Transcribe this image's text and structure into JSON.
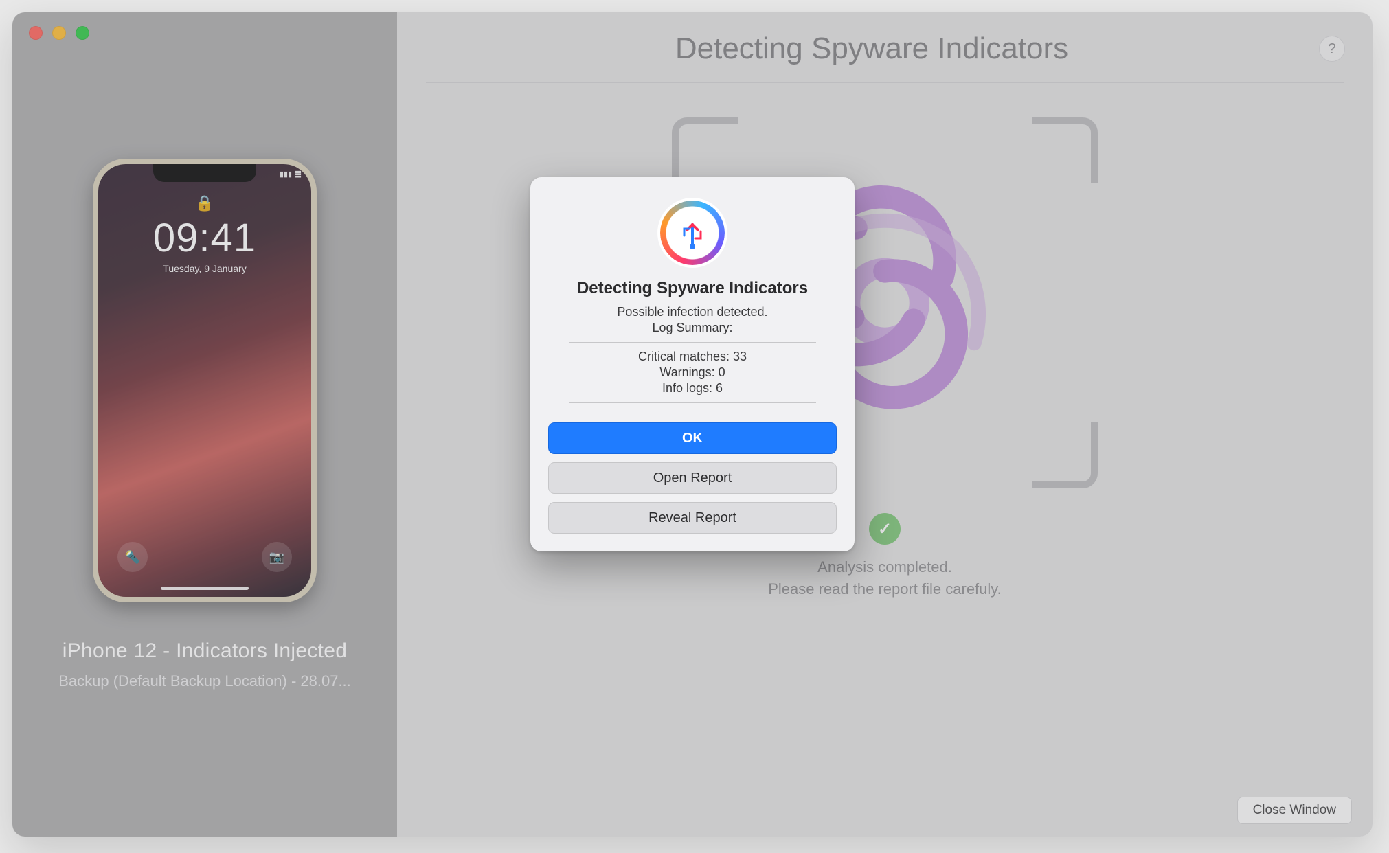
{
  "header": {
    "title": "Detecting Spyware Indicators"
  },
  "sidebar": {
    "phone_time": "09:41",
    "phone_date": "Tuesday, 9 January",
    "device_title": "iPhone 12 - Indicators Injected",
    "device_sub": "Backup (Default Backup Location) - 28.07..."
  },
  "scan": {
    "result_line1": "Analysis completed.",
    "result_line2": "Please read the report file carefuly."
  },
  "modal": {
    "title": "Detecting Spyware Indicators",
    "line1": "Possible infection detected.",
    "line2": "Log Summary:",
    "critical_label": "Critical matches: 33",
    "warnings_label": "Warnings: 0",
    "info_label": "Info logs: 6",
    "ok": "OK",
    "open_report": "Open Report",
    "reveal_report": "Reveal Report"
  },
  "footer": {
    "close": "Close Window"
  },
  "help": "?"
}
